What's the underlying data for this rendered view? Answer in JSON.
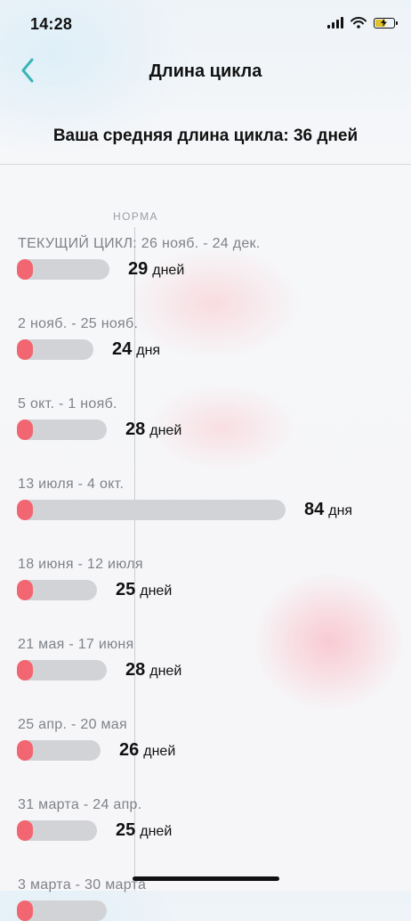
{
  "status": {
    "time": "14:28",
    "battery_level": 0.55
  },
  "header": {
    "title": "Длина цикла",
    "back_icon": "chevron-left-icon",
    "accent_color": "#3ab5b5"
  },
  "summary": {
    "average_text": "Ваша средняя длина цикла: 36 дней"
  },
  "norm_label": "НОРМА",
  "colors": {
    "period_marker": "#f16670",
    "track": "#d2d3d7"
  },
  "cycles": [
    {
      "label": "ТЕКУЩИЙ ЦИКЛ: 26 нояб. - 24 дек.",
      "days": "29",
      "unit": "дней",
      "length_days": 29
    },
    {
      "label": "2 нояб. - 25 нояб.",
      "days": "24",
      "unit": "дня",
      "length_days": 24
    },
    {
      "label": "5 окт. - 1 нояб.",
      "days": "28",
      "unit": "дней",
      "length_days": 28
    },
    {
      "label": "13 июля - 4 окт.",
      "days": "84",
      "unit": "дня",
      "length_days": 84
    },
    {
      "label": "18 июня - 12 июля",
      "days": "25",
      "unit": "дней",
      "length_days": 25
    },
    {
      "label": "21 мая - 17 июня",
      "days": "28",
      "unit": "дней",
      "length_days": 28
    },
    {
      "label": "25 апр. - 20 мая",
      "days": "26",
      "unit": "дней",
      "length_days": 26
    },
    {
      "label": "31 марта - 24 апр.",
      "days": "25",
      "unit": "дней",
      "length_days": 25
    },
    {
      "label": "3 марта - 30 марта",
      "days": "",
      "unit": "",
      "length_days": 28
    }
  ]
}
